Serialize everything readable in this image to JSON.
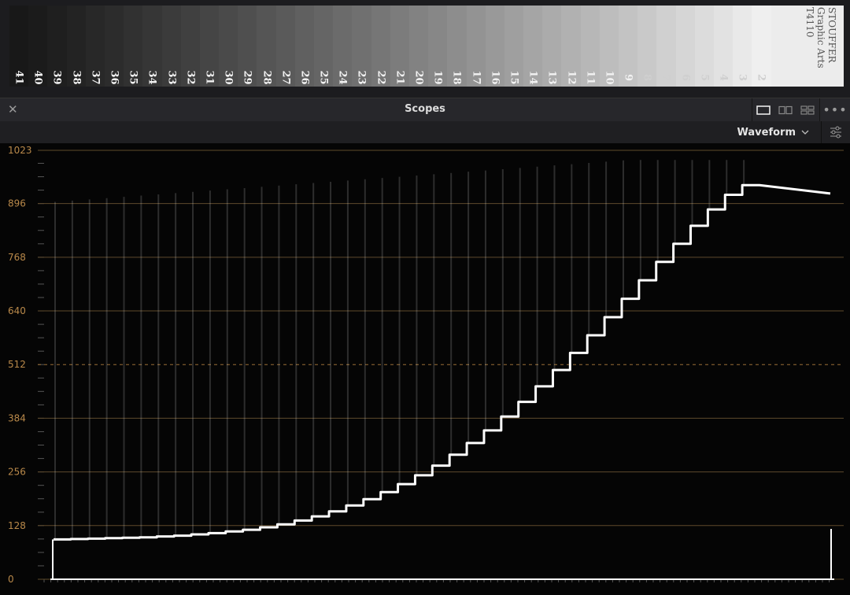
{
  "step_wedge": {
    "numbers": [
      "41",
      "40",
      "39",
      "38",
      "37",
      "36",
      "35",
      "34",
      "33",
      "32",
      "31",
      "30",
      "29",
      "28",
      "27",
      "26",
      "25",
      "24",
      "23",
      "22",
      "21",
      "20",
      "19",
      "18",
      "17",
      "16",
      "15",
      "14",
      "13",
      "12",
      "11",
      "10",
      "9",
      "8",
      "7",
      "6",
      "5",
      "4",
      "3",
      "2"
    ],
    "brand_lines": [
      "STOUFFER",
      "Graphic Arts",
      "T4110"
    ]
  },
  "scopes_panel": {
    "title": "Scopes",
    "scope_type": "Waveform",
    "layout_icons": [
      "single-layout-icon",
      "dual-layout-icon",
      "quad-layout-icon"
    ],
    "more_icon": "more-options-icon",
    "close_icon": "close-icon",
    "settings_icon": "settings-sliders-icon"
  },
  "waveform": {
    "y_labels": [
      "1023",
      "896",
      "768",
      "640",
      "512",
      "384",
      "256",
      "128",
      "0"
    ],
    "label_color": "#b9894a",
    "trace_color": "#ffffff",
    "step_levels": [
      95,
      96,
      97,
      98,
      99,
      100,
      102,
      104,
      107,
      110,
      114,
      118,
      124,
      131,
      140,
      150,
      162,
      176,
      191,
      208,
      227,
      248,
      271,
      297,
      325,
      355,
      388,
      423,
      460,
      499,
      540,
      582,
      625,
      669,
      713,
      757,
      800,
      843,
      882,
      917,
      940
    ]
  }
}
